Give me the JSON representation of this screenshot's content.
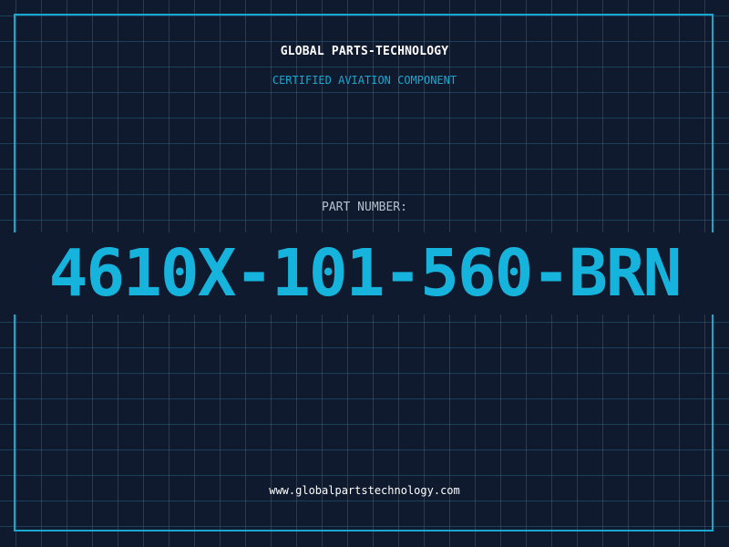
{
  "header": {
    "company_name": "GLOBAL PARTS-TECHNOLOGY",
    "tagline": "CERTIFIED AVIATION COMPONENT"
  },
  "part": {
    "label": "PART NUMBER:",
    "number": "4610X-101-560-BRN"
  },
  "footer": {
    "website": "www.globalpartstechnology.com"
  },
  "colors": {
    "background": "#0f1a2e",
    "grid": "#285f7d",
    "accent": "#1aa7cf",
    "part_number": "#16b4dc",
    "label": "#b6c0cc",
    "text": "#ffffff"
  }
}
